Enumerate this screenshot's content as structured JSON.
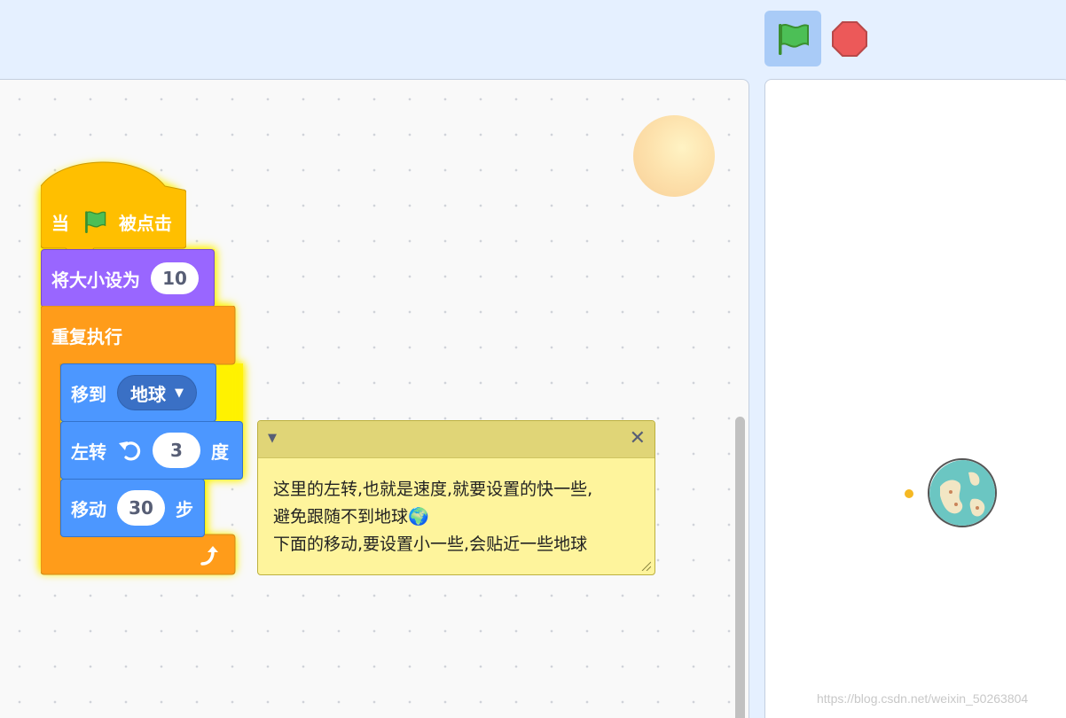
{
  "toolbar": {
    "green_flag_icon": "green-flag-icon",
    "stop_icon": "stop-icon"
  },
  "script": {
    "hat": {
      "prefix": "当",
      "suffix": "被点击",
      "icon": "green-flag-icon"
    },
    "set_size": {
      "label": "将大小设为",
      "value": "10"
    },
    "forever": {
      "label": "重复执行",
      "icon": "loop-arrow-icon"
    },
    "go_to": {
      "label": "移到",
      "target": "地球"
    },
    "turn_left": {
      "label": "左转",
      "value": "3",
      "unit": "度",
      "icon": "rotate-left-icon"
    },
    "move": {
      "label": "移动",
      "value": "30",
      "unit": "步"
    }
  },
  "comment": {
    "lines": [
      "这里的左转,也就是速度,就要设置的快一些,",
      "避免跟随不到地球🌍",
      "下面的移动,要设置小一些,会贴近一些地球"
    ]
  },
  "stage": {
    "watermark": "https://blog.csdn.net/weixin_50263804"
  },
  "colors": {
    "events": "#ffab19",
    "looks": "#9966ff",
    "control": "#ffab19",
    "motion": "#4c97ff",
    "highlight": "#fff200"
  }
}
